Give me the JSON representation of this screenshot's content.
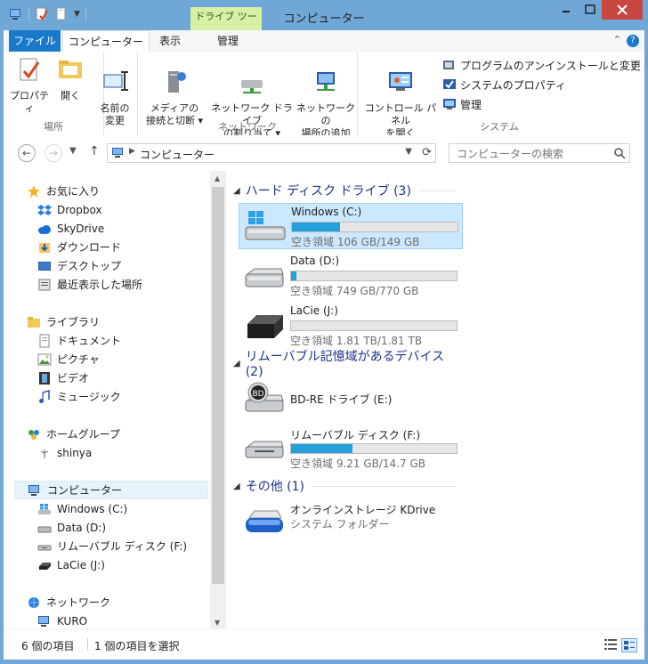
{
  "window": {
    "title": "コンピューター",
    "context_tab_group": "ドライブ ツール"
  },
  "ribbon": {
    "tabs": [
      "ファイル",
      "コンピューター",
      "表示",
      "管理"
    ],
    "groups": {
      "location": {
        "label": "場所",
        "buttons": [
          "プロパティ",
          "開く",
          "名前の\n変更"
        ]
      },
      "network": {
        "label": "ネットワーク",
        "buttons": [
          "メディアの\n接続と切断 ▾",
          "ネットワーク ドライブ\nの割り当て ▾",
          "ネットワークの\n場所の追加"
        ]
      },
      "system": {
        "label": "システム",
        "big_button": "コントロール パネル\nを開く",
        "small_buttons": [
          "プログラムのアンインストールと変更",
          "システムのプロパティ",
          "管理"
        ]
      }
    }
  },
  "address": {
    "path": "コンピューター",
    "search_placeholder": "コンピューターの検索"
  },
  "nav": {
    "favorites": {
      "header": "お気に入り",
      "items": [
        "Dropbox",
        "SkyDrive",
        "ダウンロード",
        "デスクトップ",
        "最近表示した場所"
      ]
    },
    "libraries": {
      "header": "ライブラリ",
      "items": [
        "ドキュメント",
        "ピクチャ",
        "ビデオ",
        "ミュージック"
      ]
    },
    "homegroup": {
      "header": "ホームグループ",
      "items": [
        "shinya"
      ]
    },
    "computer": {
      "header": "コンピューター",
      "items": [
        "Windows (C:)",
        "Data (D:)",
        "リムーバブル ディスク (F:)",
        "LaCie (J:)"
      ]
    },
    "network": {
      "header": "ネットワーク",
      "items": [
        "KURO"
      ]
    }
  },
  "content": {
    "groups": [
      {
        "title": "ハード ディスク ドライブ (3)",
        "drives": [
          {
            "name": "Windows (C:)",
            "free": "空き領域 106 GB/149 GB",
            "used_fraction": 0.29
          },
          {
            "name": "Data (D:)",
            "free": "空き領域 749 GB/770 GB",
            "used_fraction": 0.03
          },
          {
            "name": "LaCie (J:)",
            "free": "空き領域 1.81 TB/1.81 TB",
            "used_fraction": 0.0
          }
        ]
      },
      {
        "title": "リムーバブル記憶域があるデバイス (2)",
        "drives": [
          {
            "name": "BD-RE ドライブ (E:)"
          },
          {
            "name": "リムーバブル ディスク (F:)",
            "free": "空き領域 9.21 GB/14.7 GB",
            "used_fraction": 0.37
          }
        ]
      },
      {
        "title": "その他 (1)",
        "drives": [
          {
            "name": "オンラインストレージ KDrive",
            "subtitle": "システム フォルダー"
          }
        ]
      }
    ]
  },
  "status": {
    "item_count": "6 個の項目",
    "selected": "1 個の項目を選択"
  },
  "colors": {
    "frame": "#6fa7d7",
    "file_tab": "#1979ca",
    "close_button": "#c7463f",
    "context_tab": "#d7f0a6",
    "usage_bar": "#26a0da",
    "selection": "#cce8ff",
    "group_header": "#1e3287"
  }
}
